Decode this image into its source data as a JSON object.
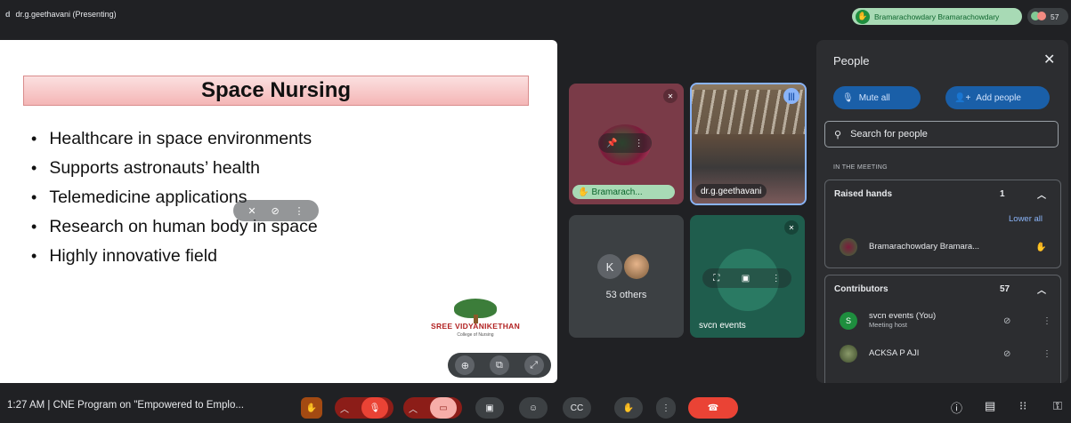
{
  "presenter": {
    "initial": "d",
    "label": "dr.g.geethavani (Presenting)"
  },
  "raised_hand_chip": {
    "name": "Bramarachowdary Bramarachowdary"
  },
  "participant_count": "57",
  "slide": {
    "title": "Space Nursing",
    "bullets": [
      "Healthcare in space environments",
      "Supports astronauts’ health",
      "Telemedicine applications",
      "Research on human body in space",
      "Highly innovative field"
    ],
    "logo_name": "SREE VIDYANIKETHAN",
    "logo_sub": "College of Nursing"
  },
  "tiles": {
    "t1_name": "Bramarach...",
    "t2_name": "dr.g.geethavani",
    "t3_initial": "K",
    "t3_label": "53 others",
    "t4_name": "svcn events"
  },
  "people_panel": {
    "title": "People",
    "mute_all": "Mute all",
    "add_people": "Add people",
    "search_placeholder": "Search for people",
    "section_label": "IN THE MEETING",
    "raised_hands": {
      "label": "Raised hands",
      "count": "1",
      "lower_all": "Lower all",
      "person": "Bramarachowdary Bramara..."
    },
    "contributors": {
      "label": "Contributors",
      "count": "57",
      "rows": [
        {
          "initial": "S",
          "name": "svcn events (You)",
          "sub": "Meeting host"
        },
        {
          "initial": "",
          "name": "ACKSA P AJI",
          "sub": ""
        }
      ]
    }
  },
  "bottom": {
    "meeting_info": "1:27 AM  |  CNE Program on \"Empowered to Emplo..."
  },
  "colors": {
    "accent": "#8ab4f8",
    "end_call": "#ea4335",
    "hand_chip": "#a8dab5"
  }
}
